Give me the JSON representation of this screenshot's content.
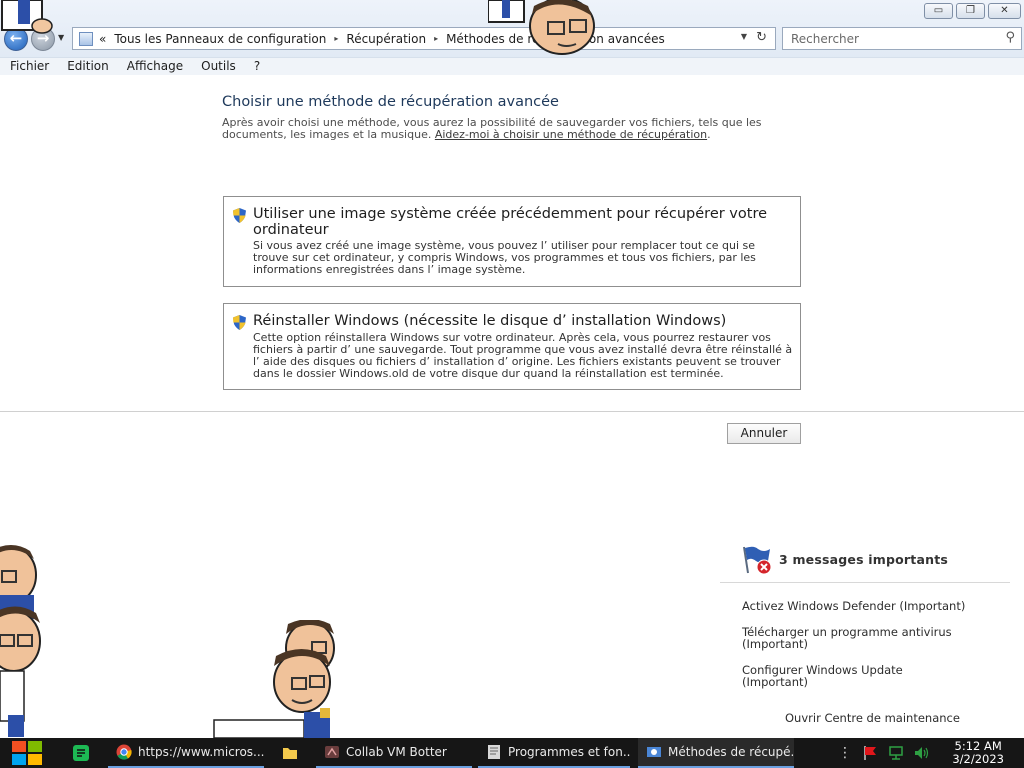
{
  "window": {
    "minimize": "▭",
    "restore": "❐",
    "close": "✕"
  },
  "address": {
    "chevrons": "«",
    "breadcrumbs": [
      "Tous les Panneaux de configuration",
      "Récupération",
      "Méthodes de récupération avancées"
    ],
    "separator": "▸"
  },
  "search": {
    "placeholder": "Rechercher"
  },
  "menu": [
    "Fichier",
    "Edition",
    "Affichage",
    "Outils",
    "?"
  ],
  "main": {
    "title": "Choisir une méthode de récupération avancée",
    "description": "Après avoir choisi une méthode, vous aurez la possibilité de sauvegarder vos fichiers, tels que les documents, les images et la musique.",
    "help_link": "Aidez-moi à choisir une méthode de récupération",
    "options": [
      {
        "title": "Utiliser une image système créée précédemment pour récupérer votre ordinateur",
        "description": "Si vous avez créé une image système, vous pouvez l’ utiliser pour remplacer tout ce qui se trouve sur cet ordinateur, y compris Windows, vos programmes et tous vos fichiers, par les informations enregistrées dans l’ image système."
      },
      {
        "title": "Réinstaller Windows (nécessite le disque d’ installation Windows)",
        "description": "Cette option réinstallera Windows sur votre ordinateur. Après cela, vous pourrez restaurer vos fichiers à partir d’ une sauvegarde. Tout programme que vous avez installé devra être réinstallé à l’ aide des disques ou fichiers d’ installation d’ origine. Les fichiers existants peuvent se trouver dans le dossier Windows.old de votre disque dur quand la réinstallation est terminée."
      }
    ],
    "cancel": "Annuler"
  },
  "action_center": {
    "title": "3 messages importants",
    "messages": [
      "Activez Windows Defender (Important)",
      "Télécharger un programme antivirus (Important)",
      "Configurer Windows Update (Important)"
    ],
    "open_link": "Ouvrir Centre de maintenance"
  },
  "taskbar": {
    "tasks": [
      "https://www.micros...",
      "Collab VM Botter",
      "Programmes et fon...",
      "Méthodes de récupé..."
    ],
    "time": "5:12 AM",
    "date": "3/2/2023"
  },
  "colors": {
    "title_blue": "#1e395b",
    "taskbar": "#161616",
    "tray_flag": "#e0161b",
    "tray_network": "#2ea043"
  }
}
